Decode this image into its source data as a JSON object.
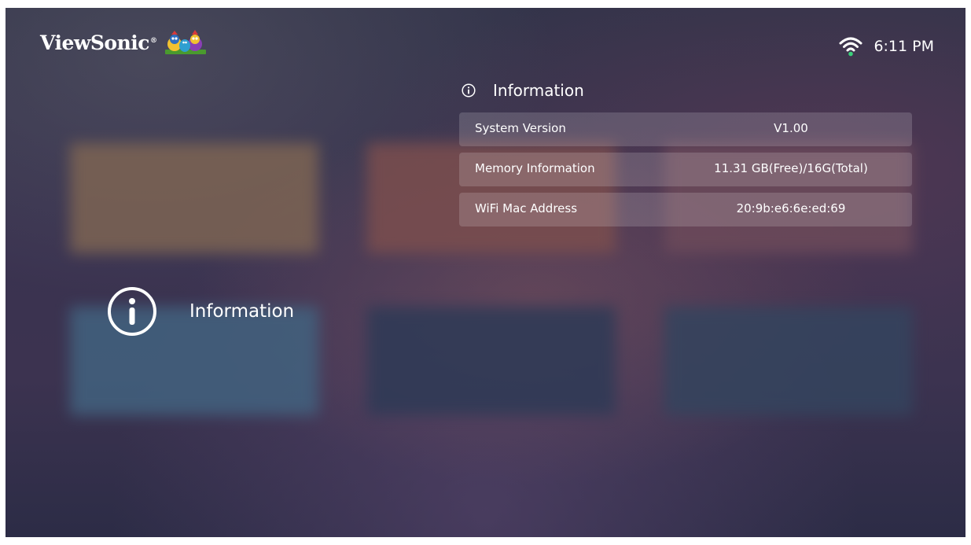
{
  "header": {
    "brand": "ViewSonic",
    "brand_mark": "®",
    "logo_icon": "viewsonic-birds-logo",
    "wifi_icon": "wifi-icon",
    "time": "6:11 PM"
  },
  "category": {
    "icon": "info-circle-icon",
    "label": "Information"
  },
  "panel": {
    "icon": "info-circle-icon",
    "title": "Information",
    "rows": [
      {
        "label": "System Version",
        "value": "V1.00"
      },
      {
        "label": "Memory Information",
        "value": "11.31 GB(Free)/16G(Total)"
      },
      {
        "label": "WiFi Mac Address",
        "value": "20:9b:e6:6e:ed:69"
      }
    ]
  },
  "colors": {
    "background": "#36344c",
    "row_background": "rgba(255,255,255,0.16)",
    "text": "#ffffff",
    "wifi_dot": "#3ad07a"
  }
}
